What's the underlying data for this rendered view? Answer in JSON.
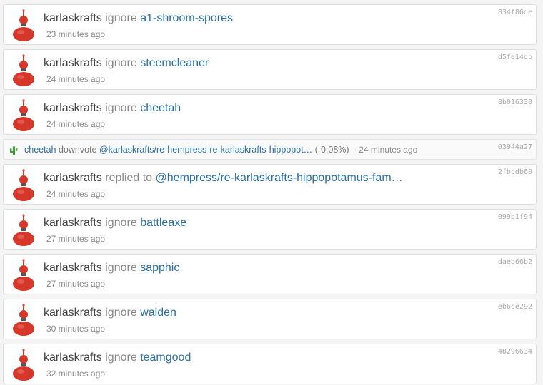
{
  "feed": [
    {
      "kind": "big",
      "user": "karlaskrafts",
      "verb": "ignore",
      "target": "a1-shroom-spores",
      "time": "23 minutes ago",
      "hash": "834f86de"
    },
    {
      "kind": "big",
      "user": "karlaskrafts",
      "verb": "ignore",
      "target": "steemcleaner",
      "time": "24 minutes ago",
      "hash": "d5fe14db"
    },
    {
      "kind": "big",
      "user": "karlaskrafts",
      "verb": "ignore",
      "target": "cheetah",
      "time": "24 minutes ago",
      "hash": "8b016330"
    },
    {
      "kind": "small",
      "user": "cheetah",
      "verb": "downvote",
      "target": "@karlaskrafts/re-hempress-re-karlaskrafts-hippopot…",
      "percent": "(-0.08%)",
      "time": "24 minutes ago",
      "hash": "03944a27"
    },
    {
      "kind": "big",
      "user": "karlaskrafts",
      "verb": "replied to",
      "target": "@hempress/re-karlaskrafts-hippopotamus-fam…",
      "time": "24 minutes ago",
      "hash": "2fbcdb60"
    },
    {
      "kind": "big",
      "user": "karlaskrafts",
      "verb": "ignore",
      "target": "battleaxe",
      "time": "27 minutes ago",
      "hash": "099b1f94"
    },
    {
      "kind": "big",
      "user": "karlaskrafts",
      "verb": "ignore",
      "target": "sapphic",
      "time": "27 minutes ago",
      "hash": "daeb66b2"
    },
    {
      "kind": "big",
      "user": "karlaskrafts",
      "verb": "ignore",
      "target": "walden",
      "time": "30 minutes ago",
      "hash": "eb6ce292"
    },
    {
      "kind": "big",
      "user": "karlaskrafts",
      "verb": "ignore",
      "target": "teamgood",
      "time": "32 minutes ago",
      "hash": "48296634"
    }
  ],
  "separator": "·",
  "icons": {
    "avatar": "robot-avatar-icon",
    "mini_avatar": "cactus-avatar-icon"
  },
  "colors": {
    "link": "#2a6fa8",
    "card_bg": "#ffffff",
    "page_bg": "#f4f4f4",
    "avatar_red": "#d6372b"
  }
}
